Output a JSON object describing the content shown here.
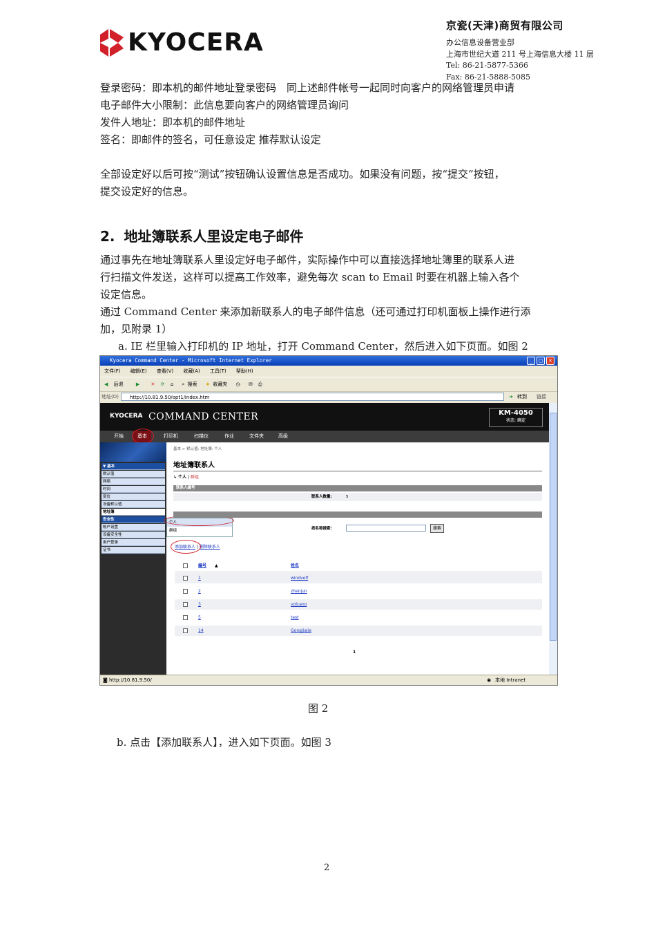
{
  "header": {
    "brand_name": "KYOCERA",
    "company_name": "京瓷(天津)商贸有限公司",
    "department": "办公信息设备营业部",
    "address": "上海市世纪大道 211 号上海信息大楼 11 层",
    "tel": "Tel: 86-21-5877-5366",
    "fax": "Fax: 86-21-5888-5085"
  },
  "intro_lines": [
    "登录密码：即本机的邮件地址登录密码　同上述邮件帐号一起同时向客户的网络管理员申请",
    "电子邮件大小限制：此信息要向客户的网络管理员询问",
    "发件人地址：即本机的邮件地址",
    "签名：即邮件的签名，可任意设定  推荐默认设定"
  ],
  "summary_lines": [
    "全部设定好以后可按“测试”按钮确认设置信息是否成功。如果没有问题，按“提交”按钮，",
    "提交设定好的信息。"
  ],
  "section": {
    "number": "2.",
    "title": "地址簿联系人里设定电子邮件"
  },
  "section_lines": [
    "通过事先在地址簿联系人里设定好电子邮件，实际操作中可以直接选择地址簿里的联系人进",
    "行扫描文件发送，这样可以提高工作效率，避免每次 scan to Email 时要在机器上输入各个",
    "设定信息。",
    "通过 Command Center 来添加新联系人的电子邮件信息（还可通过打印机面板上操作进行添",
    "加，见附录 1）"
  ],
  "step_a": "a. IE 栏里输入打印机的 IP 地址，打开 Command Center，然后进入如下页面。如图 2",
  "screenshot": {
    "window_title": "Kyocera Command Center - Microsoft Internet Explorer",
    "menu": [
      "文件(F)",
      "编辑(E)",
      "查看(V)",
      "收藏(A)",
      "工具(T)",
      "帮助(H)"
    ],
    "toolbar": [
      "后退",
      "搜索",
      "收藏夹"
    ],
    "address_label": "地址(D)",
    "address": "http://10.81.9.50/opt1/index.htm",
    "go": "转到",
    "links": "链接",
    "cc_brand": "KYOCERA",
    "cc_title": "COMMAND CENTER",
    "model": "KM-4050",
    "status": "状态: 确定",
    "tabs": [
      "开始",
      "基本",
      "打印机",
      "扫描仪",
      "作业",
      "文件夹",
      "高级"
    ],
    "breadcrumb": "基本 > 默认值: 地址簿: 个人",
    "sidebar": [
      "▼ 基本",
      "默认值",
      "网络",
      "时间",
      "复位",
      "设备默认值",
      "地址簿",
      "安全性",
      "帐户设置",
      "设备安全性",
      "用户登录",
      "证书"
    ],
    "flyout": [
      "个人",
      "群组"
    ],
    "page_heading": "地址簿联系人",
    "subnav_current": "个人",
    "subnav_other": "群组",
    "section_bar1": "联系人编号",
    "count_label": "联系人数量:",
    "count_value": "5",
    "search_label": "按名称搜索:",
    "search_button": "搜索",
    "add_contact": "添加联系人",
    "delete_contact": "删除联系人",
    "col_number": "编号",
    "col_name": "姓名",
    "rows": [
      {
        "num": "1",
        "name": "windvolf"
      },
      {
        "num": "2",
        "name": "zhenjun"
      },
      {
        "num": "3",
        "name": "volcano"
      },
      {
        "num": "5",
        "name": "test"
      },
      {
        "num": "14",
        "name": "GongJiajie"
      }
    ],
    "page": "1",
    "status_url": "http://10.81.9.50/",
    "zone": "本地 Intranet"
  },
  "caption": "图 2",
  "step_b": "b.  点击【添加联系人】，进入如下页面。如图 3",
  "page_number": "2",
  "colors": {
    "brand_red": "#d2202a",
    "tab_active": "#7a1015",
    "header_black": "#111111"
  }
}
